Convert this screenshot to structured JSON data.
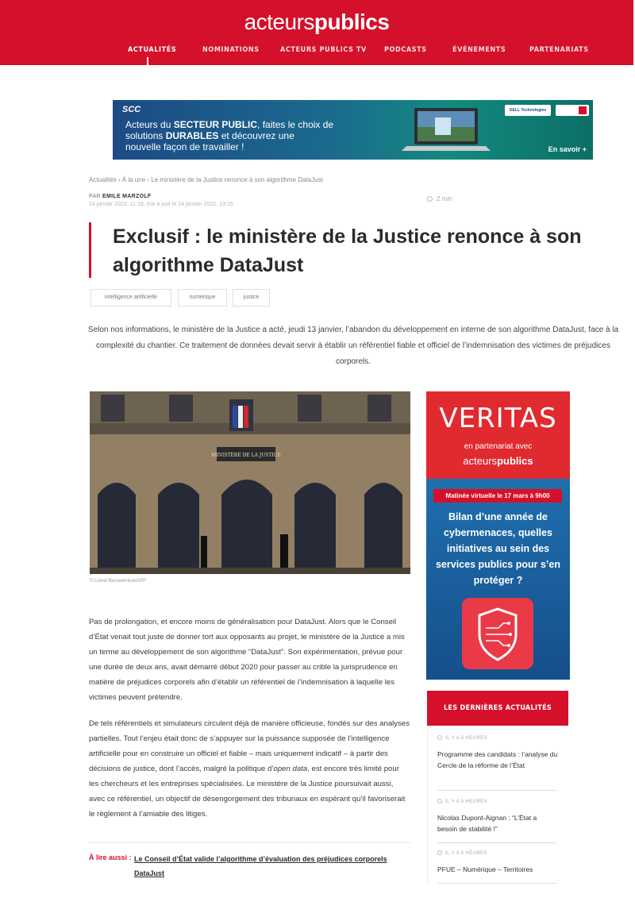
{
  "header": {
    "logo_part1": "acteurs",
    "logo_part2": "publics",
    "nav": [
      "ACTUALITÉS",
      "NOMINATIONS",
      "ACTEURS PUBLICS TV",
      "PODCASTS",
      "ÉVÉNEMENTS",
      "PARTENARIATS"
    ],
    "active_nav": "ACTUALITÉS",
    "brand_color": "#d5102a"
  },
  "banner_ad": {
    "brand": "SCC",
    "line1_pre": "Acteurs du ",
    "line1_bold": "SECTEUR PUBLIC",
    "line1_post": ", faites le choix de",
    "line2_pre": "solutions ",
    "line2_bold": "DURABLES",
    "line2_post": " et découvrez une",
    "line3": "nouvelle façon de travailler !",
    "badge": "DELL Technologies",
    "cta": "En savoir +"
  },
  "breadcrumb": [
    "Actualités",
    "À la une",
    "Le ministère de la Justice renonce à son algorithme DataJust"
  ],
  "breadcrumb_sep": " › ",
  "meta": {
    "author_prefix": "PAR ",
    "author": "EMILE MARZOLF",
    "date": "14 janvier 2022, 11:18, mis à jour le 14 janvier 2022, 13:15",
    "read_time": "2 min"
  },
  "article": {
    "title": "Exclusif : le ministère de la Justice renonce à son algorithme DataJust",
    "tags": [
      "intelligence artificielle",
      "numérique",
      "justice"
    ],
    "chapeau": "Selon nos informations, le ministère de la Justice a acté, jeudi 13 janvier, l’abandon du développement en interne de son algorithme DataJust, face à la complexité du chantier. Ce traitement de données devait servir à établir un référentiel fiable et officiel de l’indemnisation des victimes de préjudices corporels.",
    "photo_sign": "MINISTÈRE DE LA JUSTICE",
    "photo_credit": "© Lionel Bonaventure/AFP",
    "paragraph1": "Pas de prolongation, et encore moins de généralisation pour DataJust. Alors que le Conseil d’État venait tout juste de donner tort aux opposants au projet, le ministère de la Justice a mis un terme au développement de son algorithme “DataJust”. Son expérimentation, prévue pour une durée de deux ans, avait démarré début 2020 pour passer au crible la jurisprudence en matière de préjudices corporels afin d’établir un référentiel de l’indemnisation à laquelle les victimes peuvent prétendre.",
    "paragraph2_part1": "De tels référentiels et simulateurs circulent déjà de manière officieuse, fondés sur des analyses partielles. Tout l’enjeu était donc de s’appuyer sur la puissance supposée de l’intelligence artificielle pour en construire un officiel et fiable – mais uniquement indicatif – à partir des décisions de justice, dont l’accès, malgré la politique d’",
    "paragraph2_italic": "open data",
    "paragraph2_part2": ", est encore très limité pour les chercheurs et les entreprises spécialisées. Le ministère de la Justice poursuivait aussi, avec ce référentiel, un objectif de désengorgement des tribunaux en espérant qu’il favoriserait le règlement à l’amiable des litiges.",
    "read_also_label": "À lire aussi :",
    "read_also_link": "Le Conseil d’État valide l’algorithme d’évaluation des préjudices corporels DataJust"
  },
  "sidebar_ad": {
    "brand": "VERITAS",
    "partner_text": "en partenariat avec",
    "partner_logo_1": "acteurs",
    "partner_logo_2": "publics",
    "date_banner": "Matinée virtuelle le 17 mars à 9h00",
    "headline": "Bilan d’une année de cybermenaces, quelles initiatives au sein des services publics pour s’en protéger ?"
  },
  "latest_news": {
    "heading": "LES DERNIÈRES ACTUALITÉS",
    "items": [
      {
        "time": "IL Y A 5 HEURES",
        "title": "Programme des candidats : l’analyse du Cercle de la réforme de l’État"
      },
      {
        "time": "IL Y A 5 HEURES",
        "title": "Nicolas Dupont-Aignan : “L’État a besoin de stabilité !”"
      },
      {
        "time": "IL Y A 6 HEURES",
        "title": "PFUE – Numérique – Territoires"
      }
    ]
  }
}
